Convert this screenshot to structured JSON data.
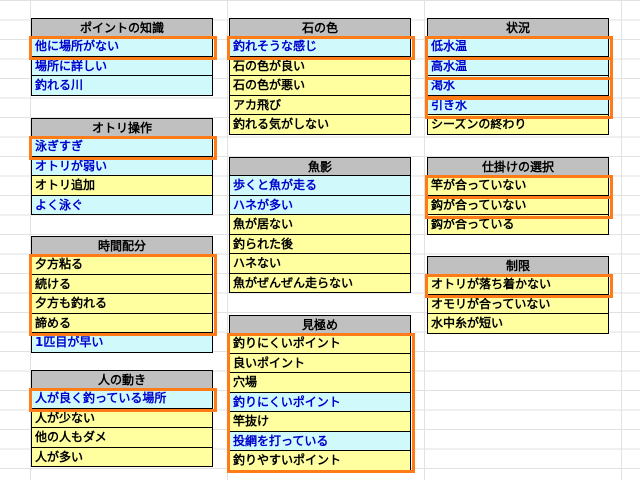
{
  "columns": [
    {
      "groups": [
        {
          "title": "ポイントの知識",
          "items": [
            {
              "text": "他に場所がない",
              "style": "c"
            },
            {
              "text": "場所に詳しい",
              "style": "c"
            },
            {
              "text": "釣れる川",
              "style": "c"
            }
          ]
        },
        {
          "title": "オトリ操作",
          "items": [
            {
              "text": "泳ぎすぎ",
              "style": "c"
            },
            {
              "text": "オトリが弱い",
              "style": "c"
            },
            {
              "text": "オトリ追加",
              "style": "y"
            },
            {
              "text": "よく泳ぐ",
              "style": "c"
            }
          ]
        },
        {
          "title": "時間配分",
          "items": [
            {
              "text": "夕方粘る",
              "style": "y"
            },
            {
              "text": "続ける",
              "style": "y"
            },
            {
              "text": "夕方も釣れる",
              "style": "y"
            },
            {
              "text": "諦める",
              "style": "y"
            },
            {
              "text": "1匹目が早い",
              "style": "c"
            }
          ]
        },
        {
          "title": "人の動き",
          "items": [
            {
              "text": "人が良く釣っている場所",
              "style": "c"
            },
            {
              "text": "人が少ない",
              "style": "y"
            },
            {
              "text": "他の人もダメ",
              "style": "y"
            },
            {
              "text": "人が多い",
              "style": "y"
            }
          ]
        }
      ]
    },
    {
      "groups": [
        {
          "title": "石の色",
          "items": [
            {
              "text": "釣れそうな感じ",
              "style": "c"
            },
            {
              "text": "石の色が良い",
              "style": "y"
            },
            {
              "text": "石の色が悪い",
              "style": "y"
            },
            {
              "text": "アカ飛び",
              "style": "y"
            },
            {
              "text": "釣れる気がしない",
              "style": "y"
            }
          ]
        },
        {
          "title": "魚影",
          "items": [
            {
              "text": "歩くと魚が走る",
              "style": "c"
            },
            {
              "text": "ハネが多い",
              "style": "c"
            },
            {
              "text": "魚が居ない",
              "style": "y"
            },
            {
              "text": "釣られた後",
              "style": "y"
            },
            {
              "text": "ハネない",
              "style": "y"
            },
            {
              "text": "魚がぜんぜん走らない",
              "style": "y"
            }
          ]
        },
        {
          "title": "見極め",
          "items": [
            {
              "text": "釣りにくいポイント",
              "style": "y"
            },
            {
              "text": "良いポイント",
              "style": "y"
            },
            {
              "text": "穴場",
              "style": "y"
            },
            {
              "text": "釣りにくいポイント",
              "style": "c"
            },
            {
              "text": "竿抜け",
              "style": "y"
            },
            {
              "text": "投網を打っている",
              "style": "c"
            },
            {
              "text": "釣りやすいポイント",
              "style": "y"
            }
          ]
        }
      ]
    },
    {
      "groups": [
        {
          "title": "状況",
          "items": [
            {
              "text": "低水温",
              "style": "c"
            },
            {
              "text": "高水温",
              "style": "c"
            },
            {
              "text": "渇水",
              "style": "c"
            },
            {
              "text": "引き水",
              "style": "c"
            },
            {
              "text": "シーズンの終わり",
              "style": "y"
            }
          ]
        },
        {
          "title": "仕掛けの選択",
          "items": [
            {
              "text": "竿が合っていない",
              "style": "y"
            },
            {
              "text": "鈎が合っていない",
              "style": "y"
            },
            {
              "text": "鈎が合っている",
              "style": "y"
            }
          ]
        },
        {
          "title": "制限",
          "items": [
            {
              "text": "オトリが落ち着かない",
              "style": "y"
            },
            {
              "text": "オモリが合っていない",
              "style": "y"
            },
            {
              "text": "水中糸が短い",
              "style": "y"
            }
          ]
        }
      ]
    }
  ],
  "colors": {
    "header_bg": "#c0c0c0",
    "yellow_cell": "#ffffa0",
    "cyan_cell": "#cff9fb",
    "cyan_text": "#0000cc",
    "highlight": "#ff7b17"
  }
}
